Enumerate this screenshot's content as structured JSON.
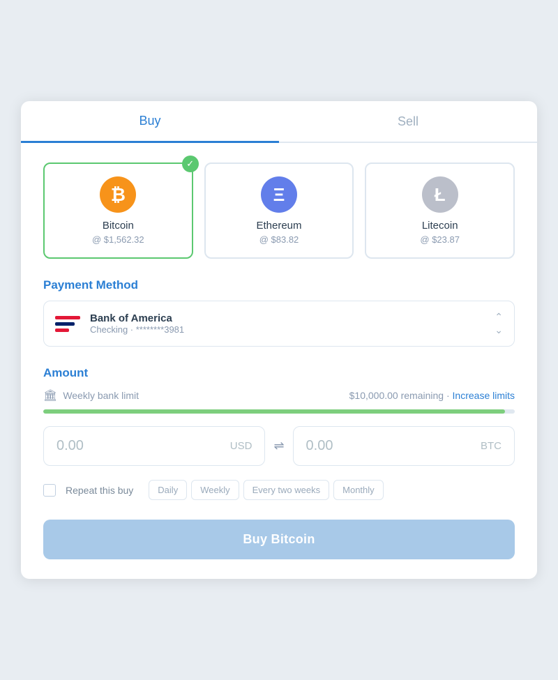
{
  "tabs": [
    {
      "id": "buy",
      "label": "Buy",
      "active": true
    },
    {
      "id": "sell",
      "label": "Sell",
      "active": false
    }
  ],
  "cryptos": [
    {
      "id": "bitcoin",
      "name": "Bitcoin",
      "price": "@ $1,562.32",
      "symbol": "₿",
      "selected": true,
      "icon_color": "bitcoin"
    },
    {
      "id": "ethereum",
      "name": "Ethereum",
      "price": "@ $83.82",
      "symbol": "Ξ",
      "selected": false,
      "icon_color": "ethereum"
    },
    {
      "id": "litecoin",
      "name": "Litecoin",
      "price": "@ $23.87",
      "symbol": "Ł",
      "selected": false,
      "icon_color": "litecoin"
    }
  ],
  "payment_method": {
    "section_label": "Payment Method",
    "bank_name": "Bank of America",
    "bank_detail": "Checking · ********3981"
  },
  "amount": {
    "section_label": "Amount",
    "limit_label": "Weekly bank limit",
    "limit_remaining": "$10,000.00 remaining",
    "limit_separator": "·",
    "increase_limits_text": "Increase limits",
    "progress_percent": 98,
    "usd_value": "0.00",
    "usd_currency": "USD",
    "btc_value": "0.00",
    "btc_currency": "BTC"
  },
  "repeat": {
    "label": "Repeat this buy",
    "frequencies": [
      "Daily",
      "Weekly",
      "Every two weeks",
      "Monthly"
    ]
  },
  "buy_button": {
    "label": "Buy Bitcoin"
  },
  "colors": {
    "active_tab": "#2b7fd4",
    "selected_border": "#5bc870",
    "progress_fill": "#7dce7d",
    "buy_btn": "#a8c9e8"
  }
}
